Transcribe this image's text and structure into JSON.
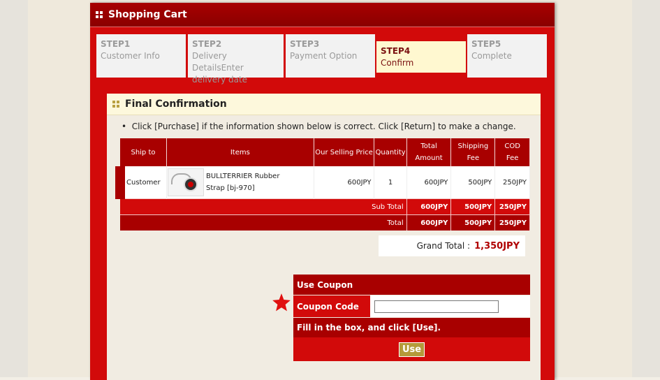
{
  "cart": {
    "title": "Shopping Cart"
  },
  "steps": [
    {
      "step": "STEP1",
      "label": "Customer Info"
    },
    {
      "step": "STEP2",
      "label": "Delivery DetailsEnter delivery date"
    },
    {
      "step": "STEP3",
      "label": "Payment Option"
    },
    {
      "step": "STEP4",
      "label": "Confirm",
      "active": true
    },
    {
      "step": "STEP5",
      "label": "Complete"
    }
  ],
  "confirmation": {
    "title": "Final Confirmation",
    "note": "Click [Purchase] if the information shown below is correct. Click [Return] to make a change."
  },
  "table": {
    "headers": {
      "ship_to": "Ship to",
      "items": "Items",
      "price": "Our Selling Price",
      "qty": "Quantity",
      "total": "Total Amount",
      "shipping": "Shipping Fee",
      "cod": "COD Fee"
    },
    "row": {
      "ship_to": "Customer",
      "item": "BULLTERRIER Rubber Strap [bj-970]",
      "price": "600JPY",
      "qty": "1",
      "total": "600JPY",
      "shipping": "500JPY",
      "cod": "250JPY"
    },
    "subtotal": {
      "label": "Sub Total",
      "total": "600JPY",
      "shipping": "500JPY",
      "cod": "250JPY"
    },
    "totals": {
      "label": "Total",
      "total": "600JPY",
      "shipping": "500JPY",
      "cod": "250JPY"
    }
  },
  "grand_total": {
    "label": "Grand Total :",
    "value": "1,350JPY"
  },
  "coupon": {
    "title": "Use Coupon",
    "code_label": "Coupon Code",
    "code_value": "",
    "hint": "Fill in the box, and click [Use].",
    "button": "Use"
  },
  "colors": {
    "primary_red": "#d20a0a",
    "dark_red": "#a80000",
    "gold": "#b49a3a"
  },
  "icons": {
    "header_icon": "grid-squares-icon",
    "star": "star-icon"
  }
}
